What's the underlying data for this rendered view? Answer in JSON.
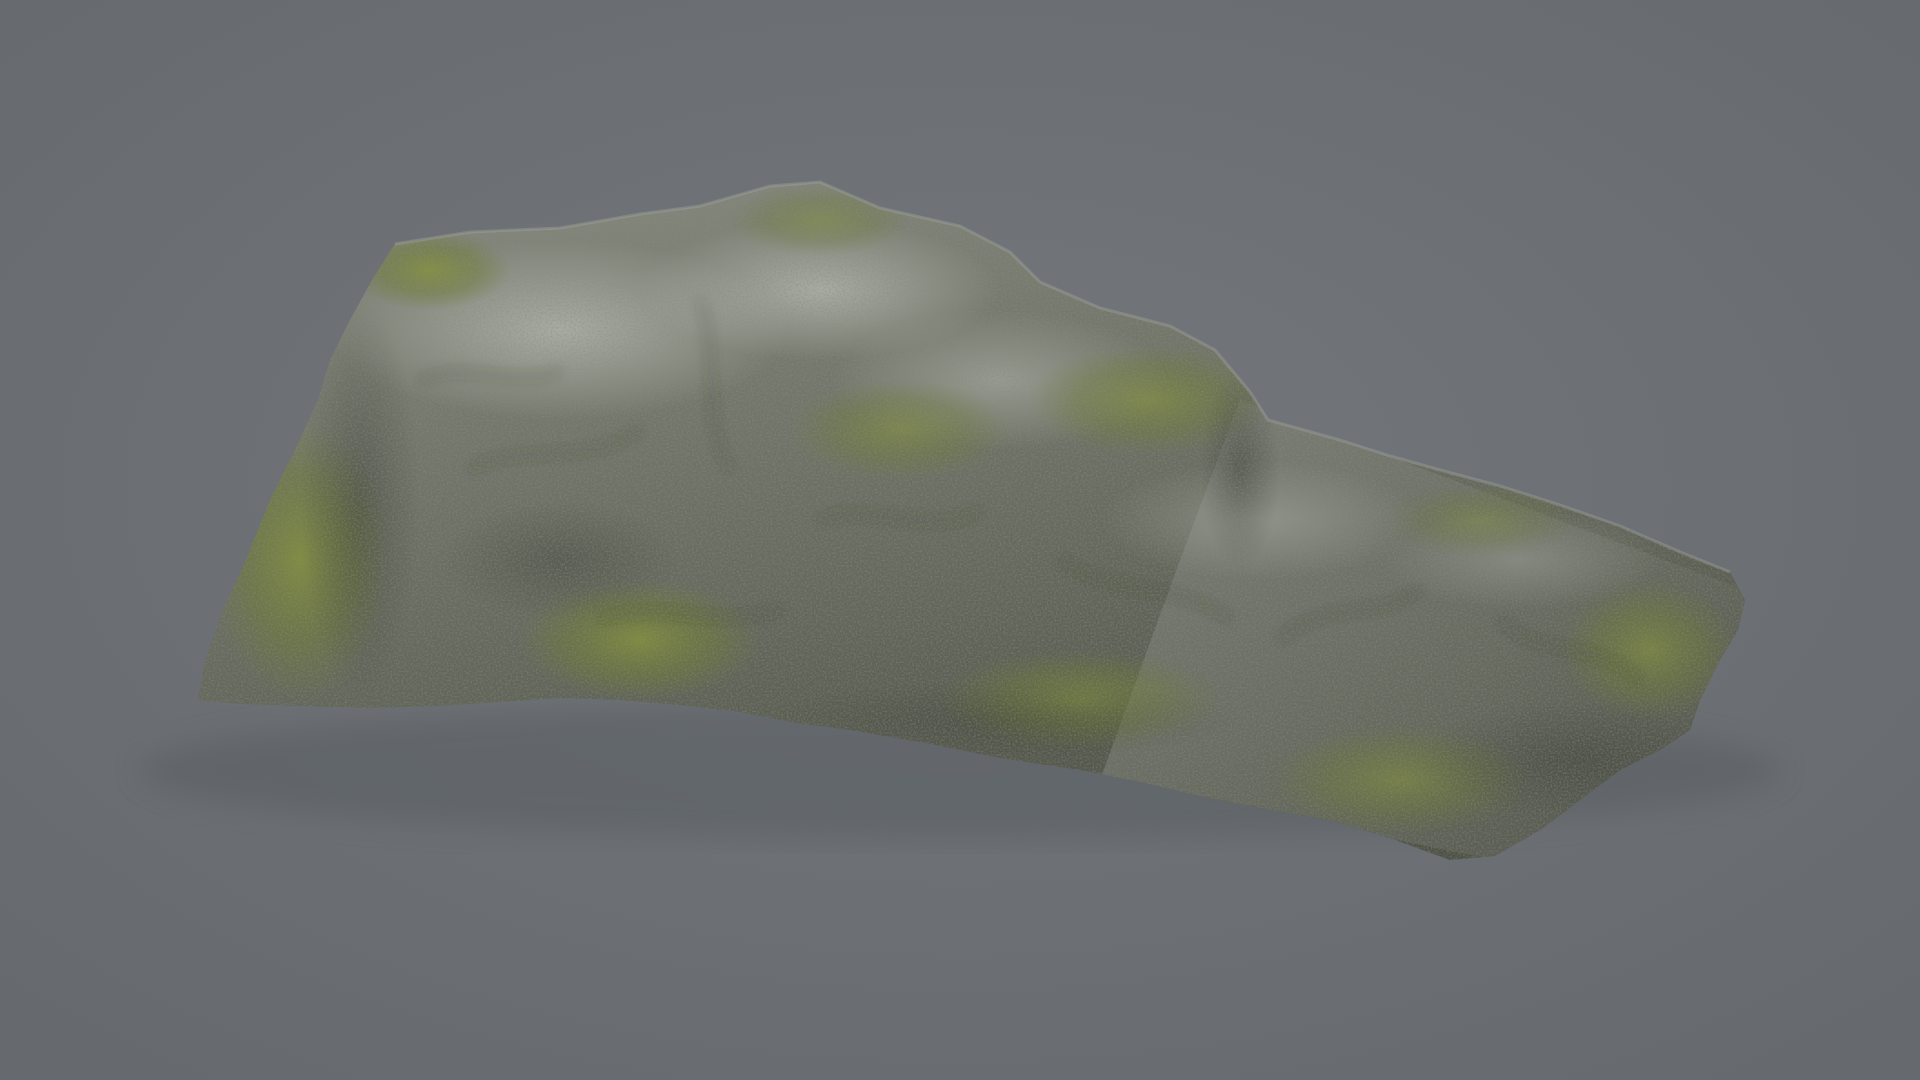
{
  "scene": {
    "subject": "moss-covered-rock",
    "colors": {
      "background_top": "#6b6f73",
      "background_bottom": "#6a6e72",
      "rock_base": "#6f7268",
      "rock_dark": "#3e423a",
      "rock_light": "#a7aba3",
      "moss": "#7d8a3c",
      "moss_dark": "#56602a"
    }
  }
}
